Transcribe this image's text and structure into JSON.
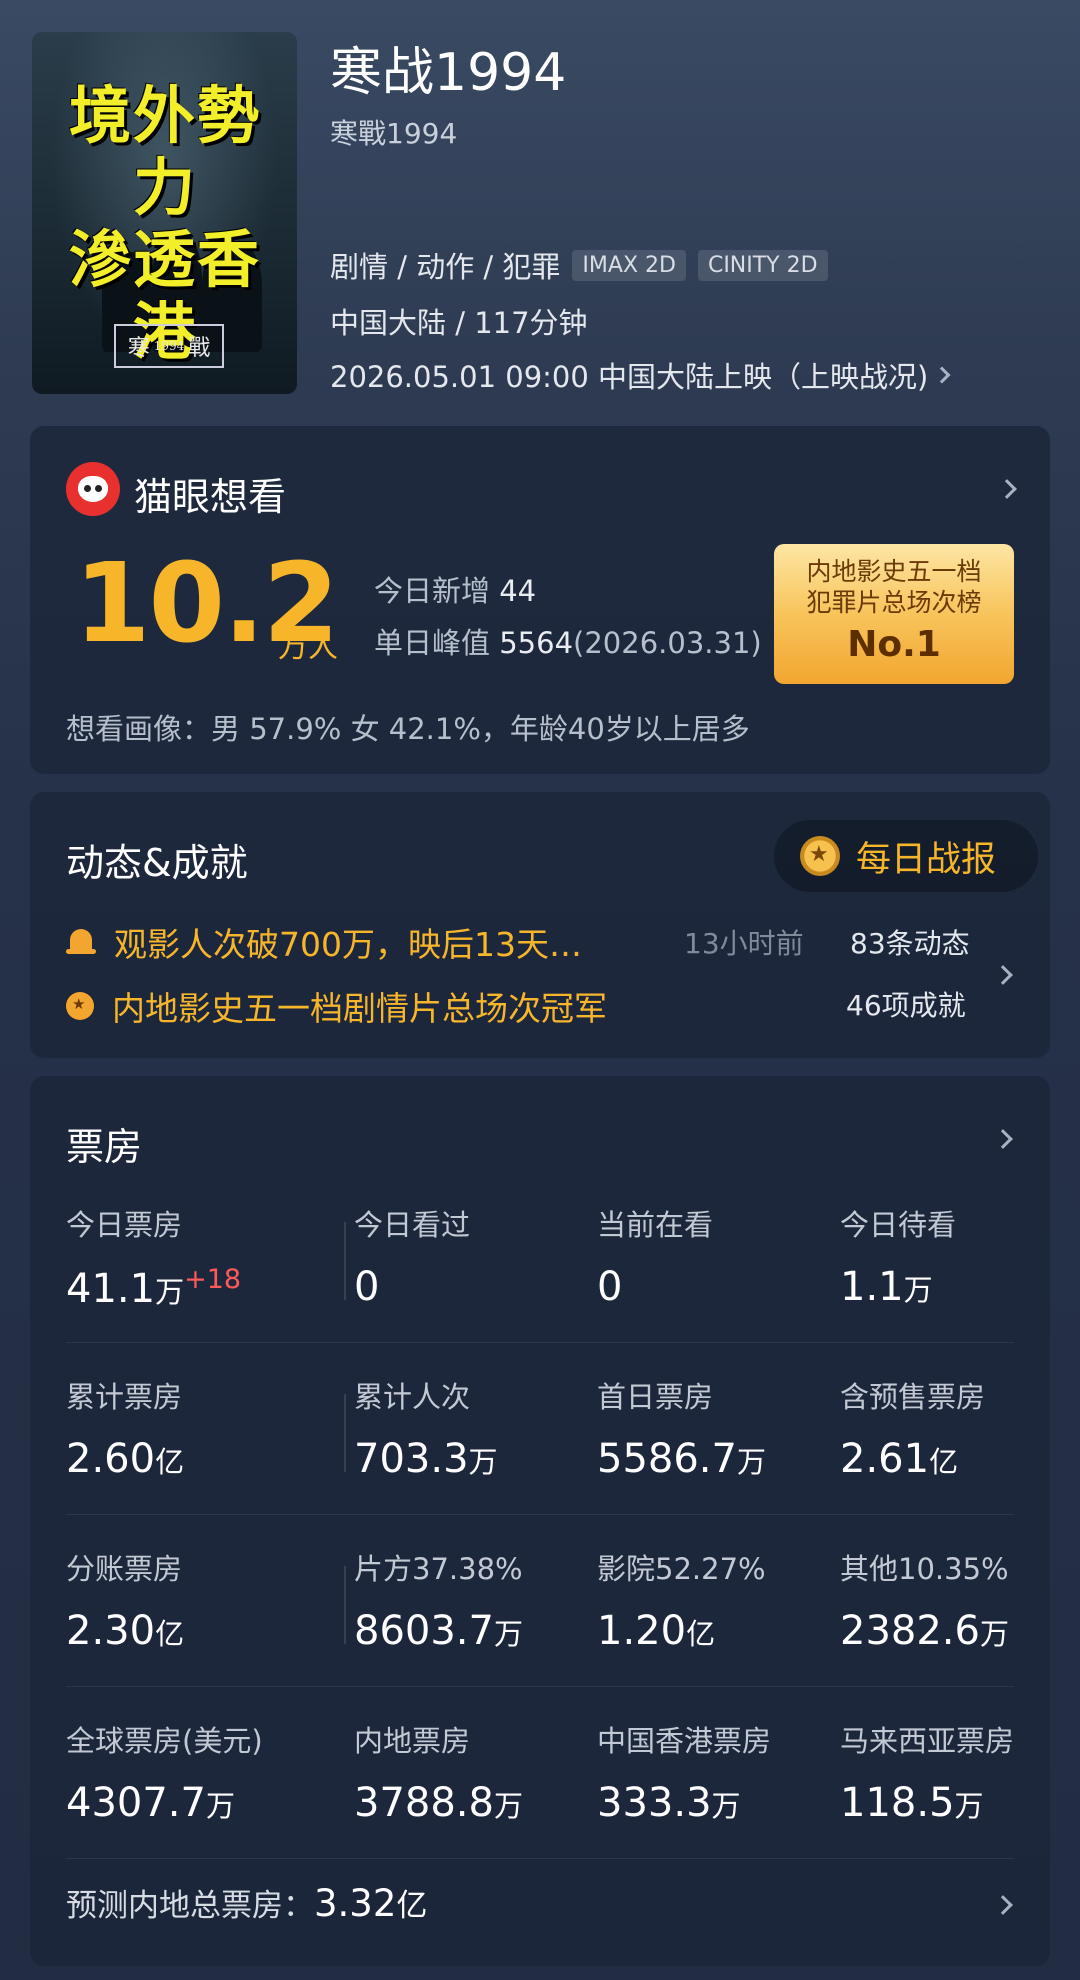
{
  "movie": {
    "title": "寒战1994",
    "subtitle": "寒戰1994",
    "genres": "剧情 / 动作 / 犯罪",
    "tags": [
      "IMAX 2D",
      "CINITY 2D"
    ],
    "region_runtime": "中国大陆 / 117分钟",
    "release": "2026.05.01 09:00 中国大陆上映（上映战况)",
    "poster": {
      "slogan_line1": "境外勢力",
      "slogan_line2": "滲透香港",
      "logo_left": "寒",
      "logo_mid": "1994",
      "logo_right": "戰"
    }
  },
  "want": {
    "title": "猫眼想看",
    "number": "10.2",
    "unit": "万人",
    "today_label": "今日新增",
    "today_value": "44",
    "peak_label": "单日峰值",
    "peak_value": "5564",
    "peak_date": "(2026.03.31)",
    "rank_line1": "内地影史五一档",
    "rank_line2": "犯罪片总场次榜",
    "rank_no": "No.1",
    "portrait": "想看画像：男 57.9%  女 42.1%，年龄40岁以上居多"
  },
  "dynamics": {
    "title": "动态&成就",
    "daily_button": "每日战报",
    "item1": "观影人次破700万，映后13天…",
    "item1_time": "13小时前",
    "item2": "内地影史五一档剧情片总场次冠军",
    "count1": "83条动态",
    "count2": "46项成就"
  },
  "boxoffice": {
    "title": "票房",
    "rows": [
      [
        {
          "label": "今日票房",
          "value": "41.1",
          "unit": "万",
          "delta": "+18"
        },
        {
          "label": "今日看过",
          "value": "0",
          "unit": ""
        },
        {
          "label": "当前在看",
          "value": "0",
          "unit": ""
        },
        {
          "label": "今日待看",
          "value": "1.1",
          "unit": "万"
        }
      ],
      [
        {
          "label": "累计票房",
          "value": "2.60",
          "unit": "亿"
        },
        {
          "label": "累计人次",
          "value": "703.3",
          "unit": "万"
        },
        {
          "label": "首日票房",
          "value": "5586.7",
          "unit": "万"
        },
        {
          "label": "含预售票房",
          "value": "2.61",
          "unit": "亿"
        }
      ],
      [
        {
          "label": "分账票房",
          "value": "2.30",
          "unit": "亿"
        },
        {
          "label": "片方37.38%",
          "value": "8603.7",
          "unit": "万"
        },
        {
          "label": "影院52.27%",
          "value": "1.20",
          "unit": "亿"
        },
        {
          "label": "其他10.35%",
          "value": "2382.6",
          "unit": "万"
        }
      ],
      [
        {
          "label": "全球票房(美元)",
          "value": "4307.7",
          "unit": "万"
        },
        {
          "label": "内地票房",
          "value": "3788.8",
          "unit": "万"
        },
        {
          "label": "中国香港票房",
          "value": "333.3",
          "unit": "万"
        },
        {
          "label": "马来西亚票房",
          "value": "118.5",
          "unit": "万"
        }
      ]
    ],
    "predict_label": "预测内地总票房：",
    "predict_value": "3.32",
    "predict_unit": "亿"
  },
  "colors": {
    "accent": "#f7b52a",
    "delta": "#ff5a5a",
    "maoyan_red": "#e8312f"
  }
}
